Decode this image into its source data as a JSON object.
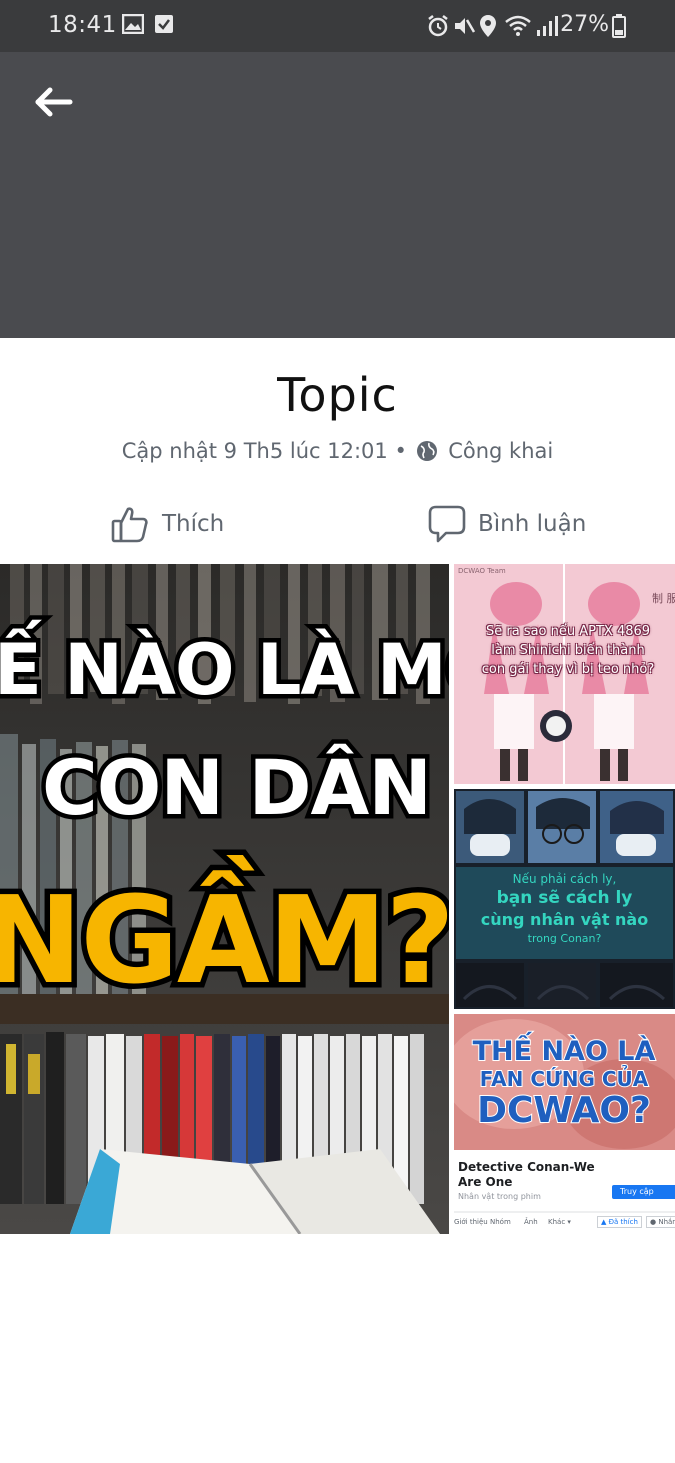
{
  "status_bar": {
    "time": "18:41",
    "battery": "27%",
    "left_icons": [
      "image-icon",
      "check-box-icon"
    ],
    "right_icons": [
      "alarm-icon",
      "mute-icon",
      "location-icon",
      "wifi-icon",
      "signal-icon",
      "battery-icon"
    ]
  },
  "album": {
    "title": "Topic",
    "updated": "Cập nhật 9 Th5 lúc 12:01",
    "separator": "•",
    "privacy": "Công khai"
  },
  "actions": {
    "like": "Thích",
    "comment": "Bình luận"
  },
  "photos": {
    "main": {
      "line1": "Ế NÀO LÀ MỘT",
      "line2": "CON DÂN FDC",
      "line3": "NGẦM?"
    },
    "photo1": {
      "tag": "DCWAO Team",
      "caption": "Sẽ ra sao nếu APTX 4869 làm Shinichi biến thành con gái thay vì bị teo nhỏ?",
      "side_text": "制 服"
    },
    "photo2": {
      "line1": "Nếu phải cách ly,",
      "line2": "bạn sẽ cách ly",
      "line3": "cùng nhân vật nào",
      "line4": "trong Conan?"
    },
    "photo3": {
      "headline1": "THẾ NÀO LÀ",
      "headline2": "FAN CỨNG CỦA",
      "headline3": "DCWAO?",
      "page_name": "Detective Conan-We Are One",
      "page_category": "Nhân vật trong phim",
      "follow_button": "Truy cập",
      "tabs": [
        "Giới thiệu",
        "Nhóm",
        "Ảnh",
        "Khác ▾"
      ],
      "liked_button": "Đã thích",
      "message_button": "Nhắn tin"
    }
  },
  "colors": {
    "status_bar": "#3a3b3d",
    "cover": "#4a4b4f",
    "meta_text": "#606770",
    "poster_yellow": "#f7b500",
    "poster_teal": "#34d6c0",
    "poster_blue": "#1f5fbf"
  }
}
